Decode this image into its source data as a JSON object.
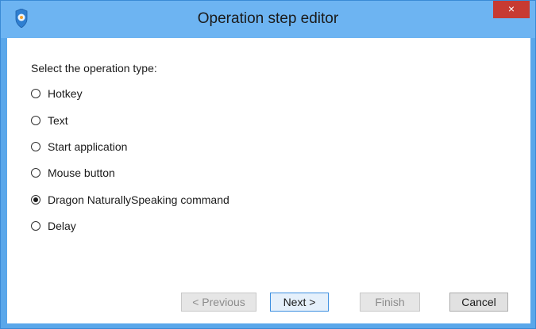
{
  "window": {
    "title": "Operation step editor",
    "close_glyph": "×",
    "titlebar_color": "#6db4f2",
    "close_color": "#c73a32"
  },
  "form": {
    "prompt": "Select the operation type:",
    "options": [
      {
        "label": "Hotkey",
        "checked": false
      },
      {
        "label": "Text",
        "checked": false
      },
      {
        "label": "Start application",
        "checked": false
      },
      {
        "label": "Mouse button",
        "checked": false
      },
      {
        "label": "Dragon NaturallySpeaking command",
        "checked": true
      },
      {
        "label": "Delay",
        "checked": false
      }
    ]
  },
  "buttons": {
    "previous": "< Previous",
    "next": "Next >",
    "finish": "Finish",
    "cancel": "Cancel"
  }
}
